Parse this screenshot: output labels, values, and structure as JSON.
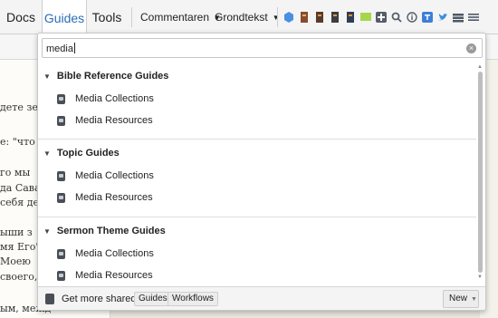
{
  "toolbar": {
    "tabs": {
      "docs": "Docs",
      "guides": "Guides",
      "tools": "Tools"
    },
    "dropdowns": {
      "commentaries": "Commentaren",
      "original_text": "Grondtekst"
    },
    "icons": [
      "hexagon-icon",
      "book-icon",
      "book-icon",
      "book-icon",
      "book-icon",
      "flag-icon",
      "plus-icon",
      "search-icon",
      "info-icon",
      "translate-icon",
      "twitter-icon",
      "layers-icon",
      "menu-icon"
    ]
  },
  "background_document": {
    "lines": [
      "дете земл",
      "е: \"что м",
      "го   мы",
      "да Савао",
      "себя дел",
      "ыши з",
      "мя Его\".",
      "Моею",
      "своего,",
      "ым, межд"
    ]
  },
  "search": {
    "value": "media"
  },
  "sections": [
    {
      "title": "Bible Reference Guides",
      "items": [
        "Media Collections",
        "Media Resources"
      ]
    },
    {
      "title": "Topic Guides",
      "items": [
        "Media Collections",
        "Media Resources"
      ]
    },
    {
      "title": "Sermon Theme Guides",
      "items": [
        "Media Collections",
        "Media Resources"
      ]
    }
  ],
  "footer": {
    "label": "Get more shared:",
    "guides": "Guides",
    "workflows": "Workflows",
    "new_button": "New"
  }
}
